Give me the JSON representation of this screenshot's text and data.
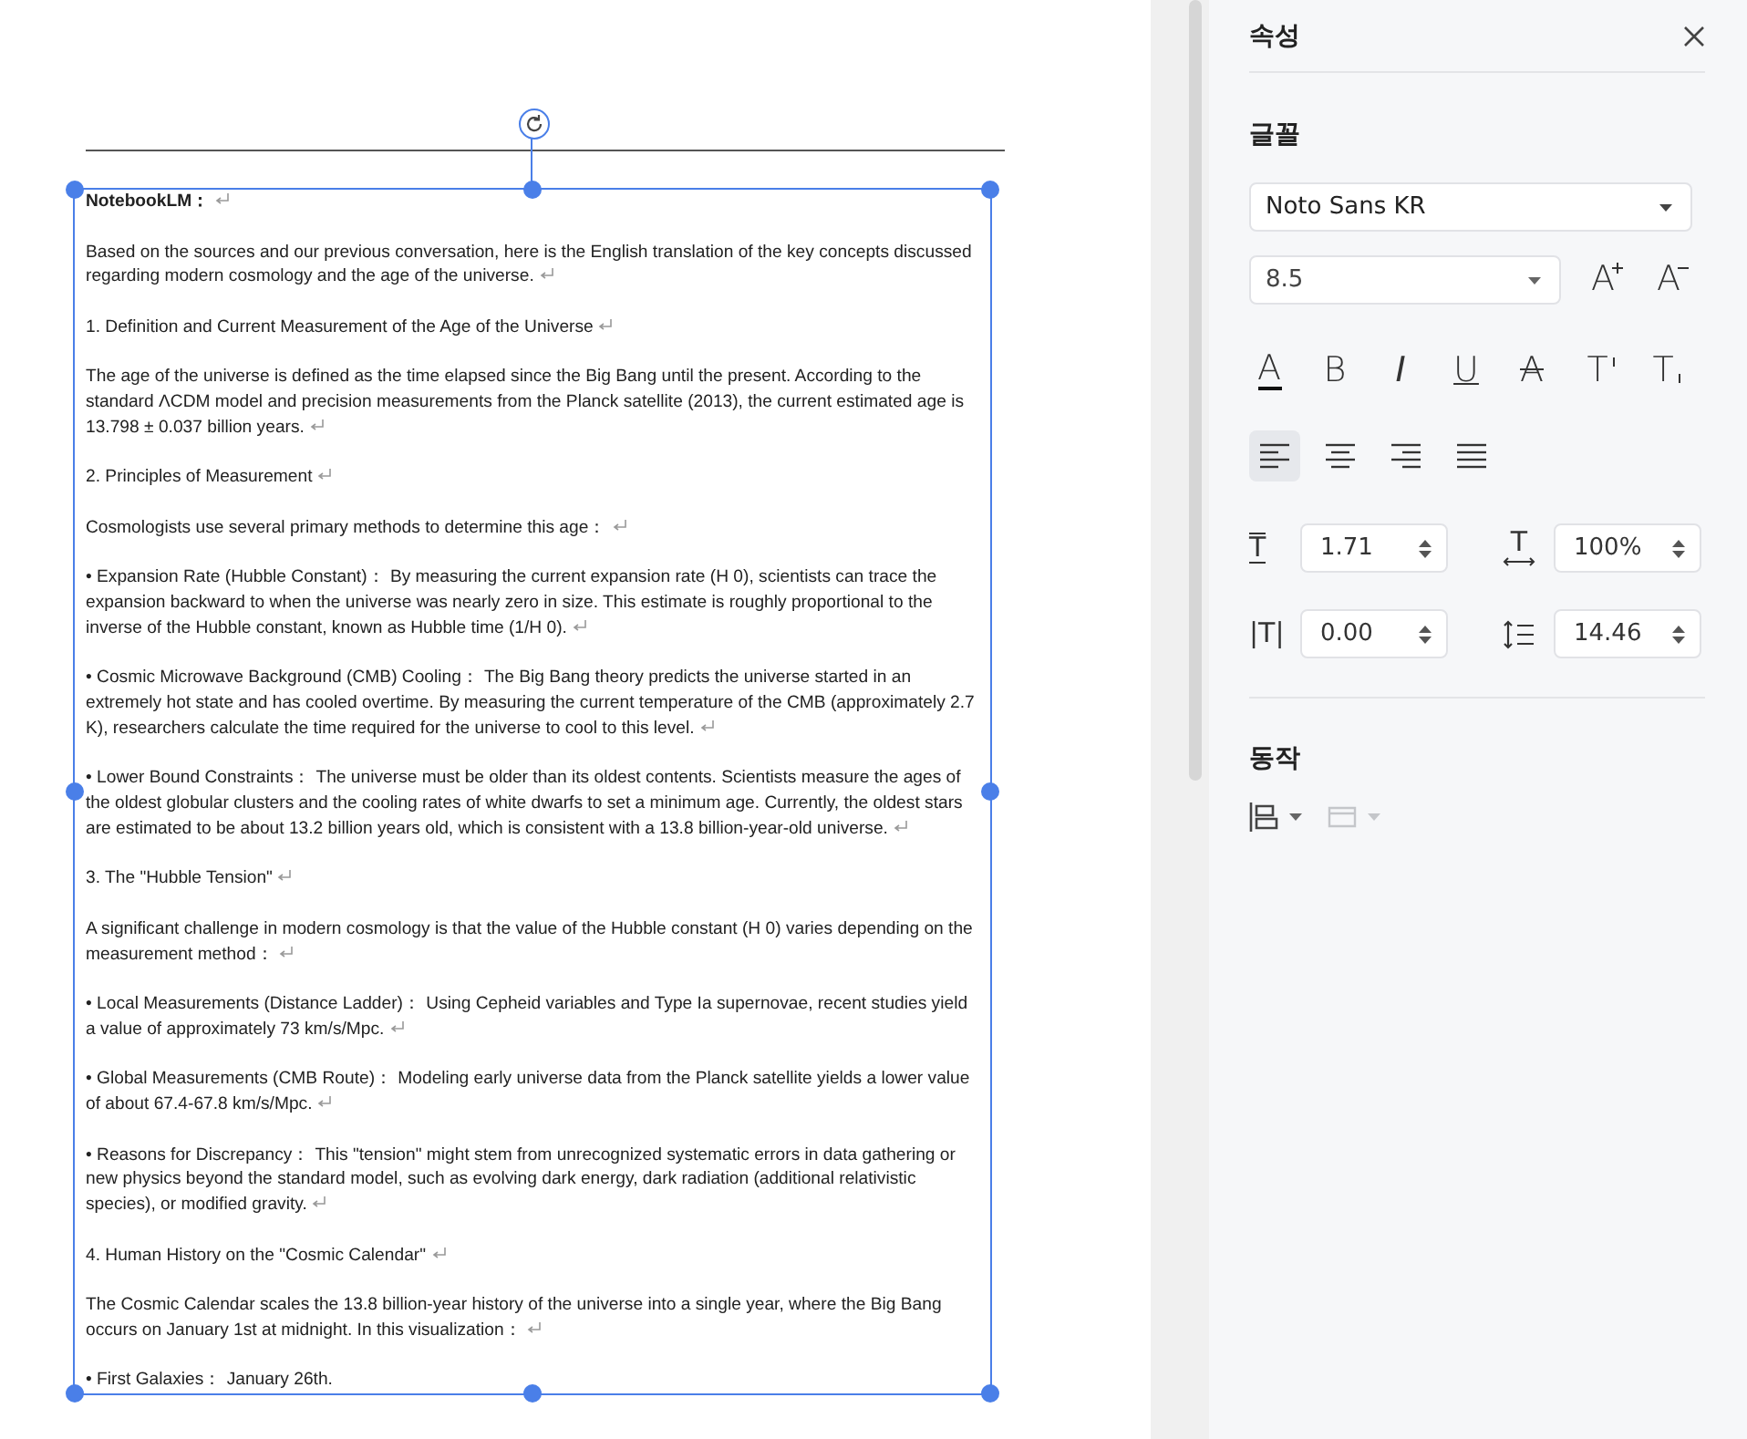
{
  "document": {
    "paragraphs": [
      {
        "text": "NotebookLM：",
        "bold": true,
        "mark": true
      },
      {
        "text": "Based on the sources and our previous conversation, here is the English translation of the key concepts discussed regarding modern cosmology and the age of the universe.",
        "bold": false,
        "mark": true
      },
      {
        "text": "1. Definition and Current Measurement of the Age of the Universe",
        "bold": false,
        "mark": true
      },
      {
        "text": "The age of the universe is defined as the time elapsed since the Big Bang until the present. According to the standard ΛCDM model and precision measurements from the Planck satellite (2013), the current estimated age is 13.798 ± 0.037 billion years.",
        "bold": false,
        "mark": true
      },
      {
        "text": "2. Principles of Measurement",
        "bold": false,
        "mark": true
      },
      {
        "text": "Cosmologists use several primary methods to determine this age：",
        "bold": false,
        "mark": true
      },
      {
        "text": "• Expansion Rate (Hubble Constant)：  By measuring the current expansion rate (H 0), scientists can trace the expansion backward to when the universe was nearly zero in size. This estimate is roughly proportional to the inverse of the Hubble constant, known as Hubble time (1/H 0).",
        "bold": false,
        "mark": true
      },
      {
        "text": "• Cosmic Microwave Background (CMB) Cooling：  The Big Bang theory predicts the universe started in an extremely hot state and has cooled overtime. By measuring the current temperature of the CMB (approximately 2.7 K), researchers calculate the time required for the universe to cool to this level.",
        "bold": false,
        "mark": true
      },
      {
        "text": "• Lower Bound Constraints：  The universe must be older than its oldest contents. Scientists measure the ages of the oldest globular clusters and the cooling rates of white dwarfs to set a minimum age. Currently, the oldest stars are estimated to be about 13.2 billion years old, which is consistent with a 13.8 billion-year-old universe.",
        "bold": false,
        "mark": true
      },
      {
        "text": "3. The \"Hubble Tension\"",
        "bold": false,
        "mark": true
      },
      {
        "text": "A significant challenge in modern cosmology is that the value of the Hubble constant (H 0) varies depending on the measurement method：",
        "bold": false,
        "mark": true
      },
      {
        "text": "• Local Measurements (Distance Ladder)：  Using Cepheid variables and Type Ia supernovae, recent studies yield a value of approximately 73 km/s/Mpc.",
        "bold": false,
        "mark": true
      },
      {
        "text": "• Global Measurements (CMB Route)：  Modeling early universe data from the Planck satellite yields a lower value of about 67.4-67.8 km/s/Mpc.",
        "bold": false,
        "mark": true
      },
      {
        "text": "• Reasons for Discrepancy：  This \"tension\" might stem from unrecognized systematic errors in data gathering or new physics beyond the standard model, such as evolving dark energy, dark radiation (additional relativistic species), or modified gravity.",
        "bold": false,
        "mark": true
      },
      {
        "text": "4. Human History on the \"Cosmic Calendar\"",
        "bold": false,
        "mark": true
      },
      {
        "text": "The Cosmic Calendar scales the 13.8 billion-year history of the universe into a single year, where the Big Bang occurs on January 1st at midnight. In this visualization：",
        "bold": false,
        "mark": true
      },
      {
        "text": "• First Galaxies：  January 26th.",
        "bold": false,
        "mark": false
      }
    ]
  },
  "properties": {
    "title": "속성",
    "font_label": "글꼴",
    "font_family": "Noto Sans KR",
    "font_size": "8.5",
    "size_buttons": [
      {
        "kind": "grow",
        "glyph": "A"
      },
      {
        "kind": "shrink",
        "glyph": "A"
      }
    ],
    "format_buttons": [
      {
        "kind": "color",
        "glyph": "A"
      },
      {
        "kind": "bold",
        "glyph": "B"
      },
      {
        "kind": "italic",
        "glyph": "I"
      },
      {
        "kind": "underline",
        "glyph": "U"
      },
      {
        "kind": "strike",
        "glyph": "A"
      },
      {
        "kind": "superscript",
        "glyph": "T"
      },
      {
        "kind": "subscript",
        "glyph": "T"
      }
    ],
    "alignment": [
      {
        "kind": "left",
        "selected": true
      },
      {
        "kind": "center",
        "selected": false
      },
      {
        "kind": "right",
        "selected": false
      },
      {
        "kind": "justify",
        "selected": false
      }
    ],
    "spacing_fields": [
      {
        "kind": "height",
        "glyph": "T",
        "value": "1.71"
      },
      {
        "kind": "width",
        "glyph": "T",
        "value": "100%"
      },
      {
        "kind": "letter",
        "glyph": "|T|",
        "value": "0.00"
      },
      {
        "kind": "line",
        "value": "14.46"
      }
    ],
    "action_label": "동작",
    "action_buttons": [
      {
        "kind": "align",
        "disabled": false
      },
      {
        "kind": "frame",
        "disabled": true
      }
    ]
  }
}
